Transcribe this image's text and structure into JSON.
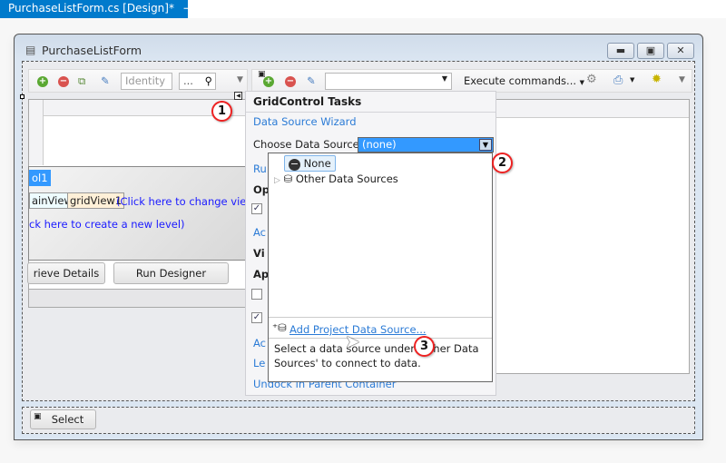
{
  "document_tab": {
    "title": "PurchaseListForm.cs [Design]*",
    "pin_icon": "pin-icon",
    "close_icon": "close-icon"
  },
  "form": {
    "title": "PurchaseListForm",
    "minimize": "▬",
    "restore": "▣",
    "close": "✕"
  },
  "left_toolbar": {
    "identity_placeholder": "Identity",
    "search_value": "...",
    "search_icon": "🔍"
  },
  "right_toolbar": {
    "combo_value": "",
    "execute_label": "Execute commands...",
    "icons": [
      "add-icon",
      "remove-icon",
      "edit-icon",
      "gears-icon",
      "printer-icon",
      "options-icon"
    ]
  },
  "level_designer": {
    "level_tab": "ol1",
    "main_view": "ainView)",
    "grid_view": "gridView1",
    "change_view": "(Click here to change view)",
    "new_level": "ck here to create a new level)",
    "retrieve_button": "rieve Details",
    "run_designer_button": "Run Designer"
  },
  "tasks": {
    "header": "GridControl Tasks",
    "wizard_link": "Data Source Wizard",
    "choose_label": "Choose Data Source",
    "choose_value": "(none)",
    "hidden_items": [
      "Ru",
      "Op",
      "Ac",
      "Vi",
      "Ap",
      "Ac",
      "Le"
    ],
    "undock_link": "Undock in Parent Container",
    "checkboxes": [
      true,
      false,
      true
    ]
  },
  "dropdown": {
    "items": [
      {
        "label": "None",
        "selected": true
      },
      {
        "label": "Other Data Sources",
        "expandable": true
      }
    ],
    "add_link": "Add Project Data Source...",
    "help": "Select a data source under 'Other Data Sources' to connect to data."
  },
  "callouts": [
    "1",
    "2",
    "3"
  ],
  "bottom": {
    "select_button": "Select"
  },
  "colors": {
    "accent": "#007acc",
    "selection": "#3399ff",
    "callout": "#e22222",
    "link": "#2b7bd6"
  }
}
